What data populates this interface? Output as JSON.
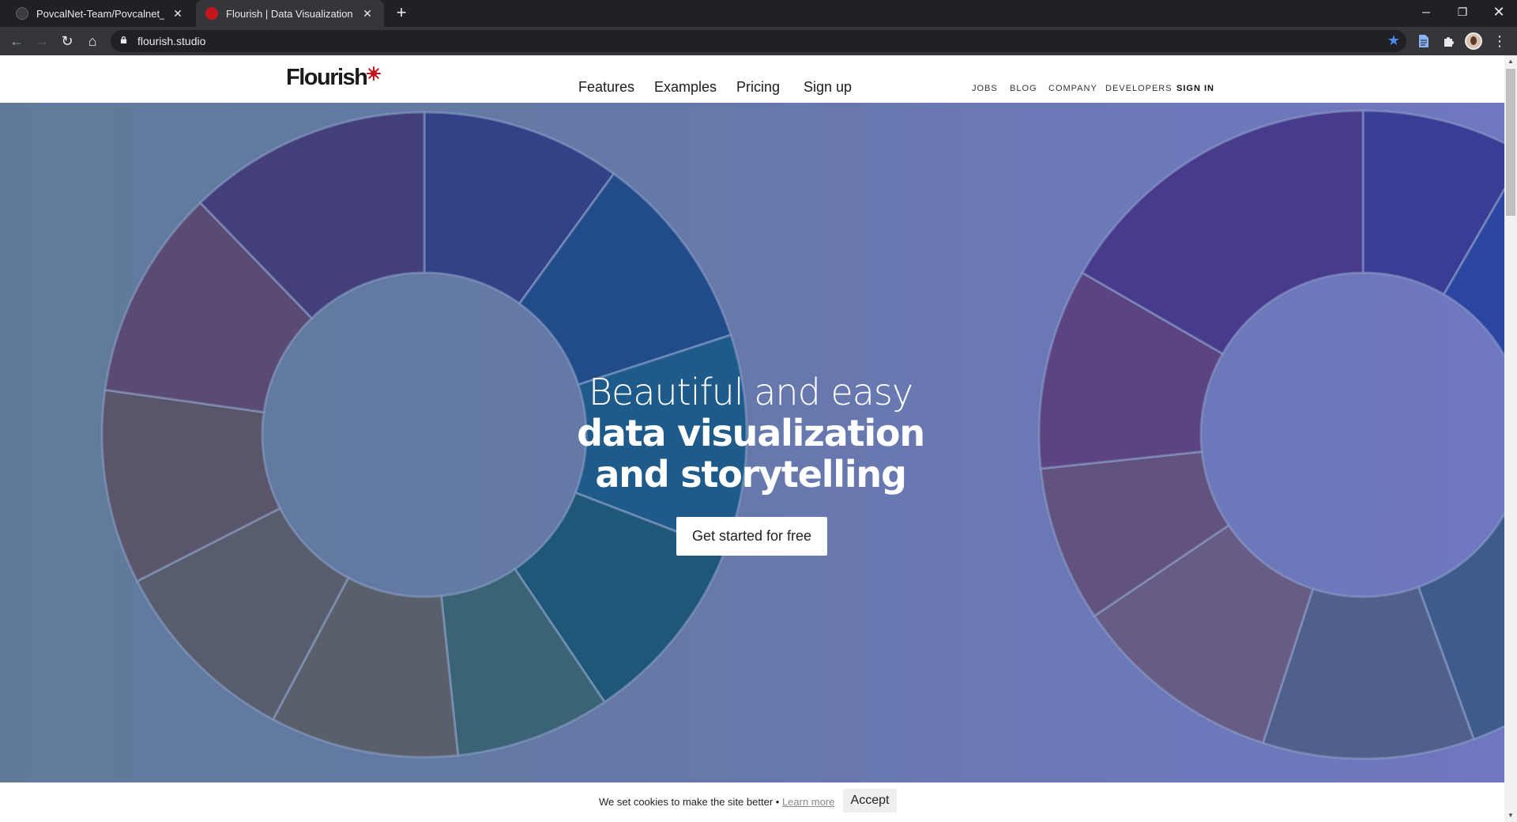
{
  "browser": {
    "tabs": [
      {
        "title": "PovcalNet-Team/Povcalnet_internal",
        "active": false
      },
      {
        "title": "Flourish | Data Visualization & Storytelling",
        "active": true
      }
    ],
    "url": "flourish.studio",
    "new_tab_icon": "plus-icon"
  },
  "site": {
    "logo_text": "Flourish",
    "main_nav": [
      "Features",
      "Examples",
      "Pricing",
      "Sign up"
    ],
    "sub_nav": [
      "JOBS",
      "BLOG",
      "COMPANY",
      "DEVELOPERS",
      "SIGN IN"
    ]
  },
  "hero": {
    "line1": "Beautiful and easy",
    "line2": "data visualization",
    "line3": "and storytelling",
    "cta": "Get started for free"
  },
  "cookie": {
    "text": "We set cookies to make the site better •",
    "link": "Learn more",
    "accept": "Accept"
  },
  "colors": {
    "brand_red": "#c4161c",
    "chat_button": "#1e8ab2"
  }
}
